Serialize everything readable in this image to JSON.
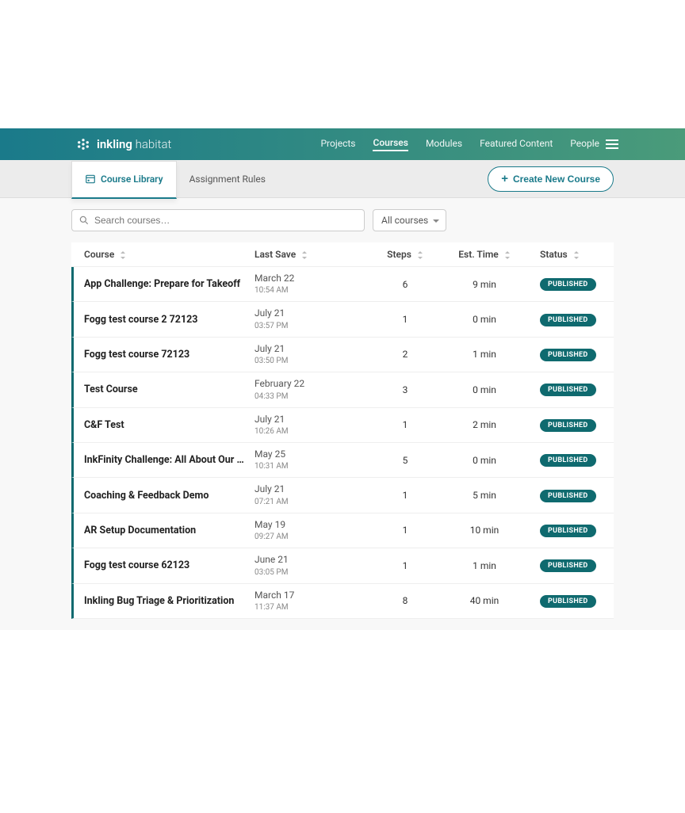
{
  "brand": {
    "strong": "inkling",
    "light": "habitat"
  },
  "nav": {
    "items": [
      "Projects",
      "Courses",
      "Modules",
      "Featured Content",
      "People"
    ],
    "activeIndex": 1
  },
  "subtabs": {
    "items": [
      "Course Library",
      "Assignment Rules"
    ],
    "activeIndex": 0
  },
  "createButton": {
    "label": "Create New Course"
  },
  "search": {
    "placeholder": "Search courses…"
  },
  "filter": {
    "selected": "All courses"
  },
  "columns": {
    "course": "Course",
    "lastSave": "Last Save",
    "steps": "Steps",
    "estTime": "Est. Time",
    "status": "Status"
  },
  "rows": [
    {
      "title": "App Challenge: Prepare for Takeoff",
      "date": "March 22",
      "time": "10:54 AM",
      "steps": "6",
      "etime": "9 min",
      "status": "PUBLISHED"
    },
    {
      "title": "Fogg test course 2 72123",
      "date": "July 21",
      "time": "03:57 PM",
      "steps": "1",
      "etime": "0 min",
      "status": "PUBLISHED"
    },
    {
      "title": "Fogg test course 72123",
      "date": "July 21",
      "time": "03:50 PM",
      "steps": "2",
      "etime": "1 min",
      "status": "PUBLISHED"
    },
    {
      "title": "Test Course",
      "date": "February 22",
      "time": "04:33 PM",
      "steps": "3",
      "etime": "0 min",
      "status": "PUBLISHED"
    },
    {
      "title": "C&F Test",
      "date": "July 21",
      "time": "10:26 AM",
      "steps": "1",
      "etime": "2 min",
      "status": "PUBLISHED"
    },
    {
      "title": "InkFinity Challenge: All About Our In…",
      "date": "May 25",
      "time": "10:31 AM",
      "steps": "5",
      "etime": "0 min",
      "status": "PUBLISHED"
    },
    {
      "title": "Coaching & Feedback Demo",
      "date": "July 21",
      "time": "07:21 AM",
      "steps": "1",
      "etime": "5 min",
      "status": "PUBLISHED"
    },
    {
      "title": "AR Setup Documentation",
      "date": "May 19",
      "time": "09:27 AM",
      "steps": "1",
      "etime": "10 min",
      "status": "PUBLISHED"
    },
    {
      "title": "Fogg test course 62123",
      "date": "June 21",
      "time": "03:05 PM",
      "steps": "1",
      "etime": "1 min",
      "status": "PUBLISHED"
    },
    {
      "title": "Inkling Bug Triage & Prioritization",
      "date": "March 17",
      "time": "11:37 AM",
      "steps": "8",
      "etime": "40 min",
      "status": "PUBLISHED"
    }
  ]
}
